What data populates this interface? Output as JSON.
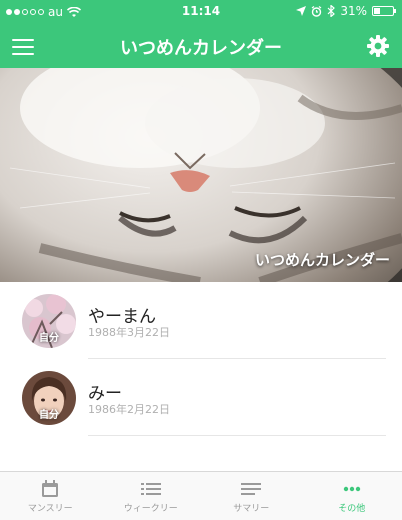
{
  "status_bar": {
    "carrier": "au",
    "time": "11:14",
    "battery_percent": "31%",
    "battery_level": 0.31,
    "signal_bars": 2
  },
  "nav": {
    "title": "いつめんカレンダー",
    "left_icon": "menu-icon",
    "right_icon": "gear-icon"
  },
  "hero": {
    "caption": "いつめんカレンダー"
  },
  "members": [
    {
      "name": "やーまん",
      "birthday": "1988年3月22日",
      "tag": "自分"
    },
    {
      "name": "みー",
      "birthday": "1986年2月22日",
      "tag": "自分"
    }
  ],
  "tabs": [
    {
      "label": "マンスリー",
      "icon": "calendar-icon"
    },
    {
      "label": "ウィークリー",
      "icon": "list-icon"
    },
    {
      "label": "サマリー",
      "icon": "summary-icon"
    },
    {
      "label": "その他",
      "icon": "more-icon"
    }
  ],
  "colors": {
    "accent": "#3cc77b",
    "inactive_tab": "#9a9a9a",
    "date_text": "#b0b0b0"
  }
}
